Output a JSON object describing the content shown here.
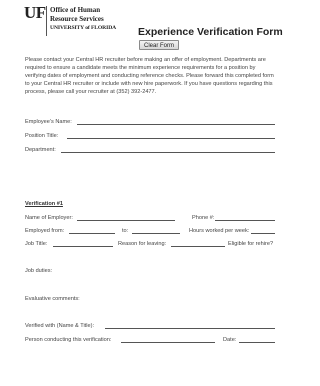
{
  "header": {
    "logo_mark": "UF",
    "logo_line1": "Office of Human",
    "logo_line2": "Resource Services",
    "logo_line3": "UNIVERSITY of FLORIDA",
    "title": "Experience Verification Form",
    "clear_button": "Clear Form"
  },
  "intro": "Please contact your Central HR recruiter before making an offer of employment. Departments are required to ensure a candidate meets the minimum experience requirements for a position by verifying dates of employment and conducting reference checks. Please forward this completed form to your Central HR recruiter or include with new hire paperwork. If you have questions regarding this process, please call your recruiter at (352) 392-2477.",
  "fields": {
    "employee_name": "Employee’s Name:",
    "position_title": "Position Title:",
    "department": "Department:"
  },
  "verification": {
    "heading": "Verification #1",
    "name_of_employer": "Name of Employer:",
    "phone": "Phone #:",
    "employed_from": "Employed from:",
    "to": "to:",
    "hours_per_week": "Hours worked per week:",
    "job_title": "Job Title:",
    "reason_for_leaving": "Reason for leaving:",
    "eligible_for_rehire": "Eligible for rehire?",
    "job_duties": "Job duties:",
    "evaluative_comments": "Evaluative comments:",
    "verified_with": "Verified with (Name & Title):",
    "person_conducting": "Person conducting this verification:",
    "date": "Date:"
  }
}
